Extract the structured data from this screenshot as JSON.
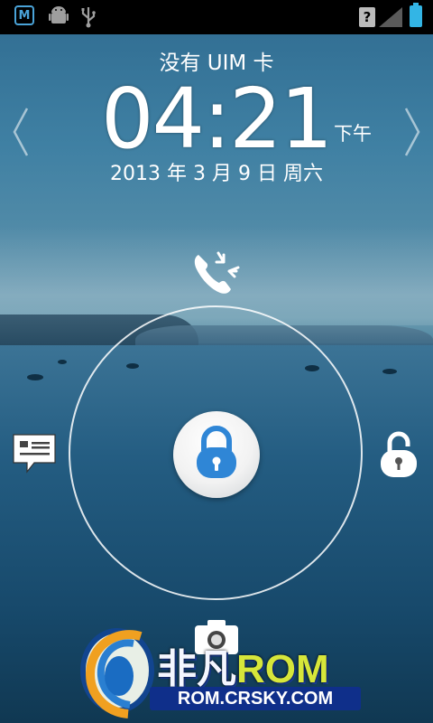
{
  "status_bar": {
    "left_icons": [
      "maps-notification-icon",
      "android-debug-icon",
      "usb-icon"
    ],
    "left_badge_letter": "M",
    "right_icons": [
      "no-sim-icon",
      "signal-icon",
      "battery-icon"
    ],
    "no_sim_glyph": "?"
  },
  "lockscreen": {
    "carrier": "没有 UIM 卡",
    "time": "04:21",
    "ampm": "下午",
    "date": "2013 年 3 月 9 日 周六"
  },
  "targets": {
    "top": "phone-icon",
    "left": "messages-icon",
    "right": "unlock-icon",
    "bottom": "camera-icon",
    "center": "lock-handle-icon"
  },
  "watermark": {
    "brand_cn": "非凡",
    "brand_rom": "ROM",
    "url": "ROM.CRSKY.COM",
    "colors": {
      "rom": "#d7e63a",
      "url_bg": "#0f2f8a"
    }
  },
  "colors": {
    "accent": "#2f86d6",
    "battery": "#33b5e5"
  }
}
